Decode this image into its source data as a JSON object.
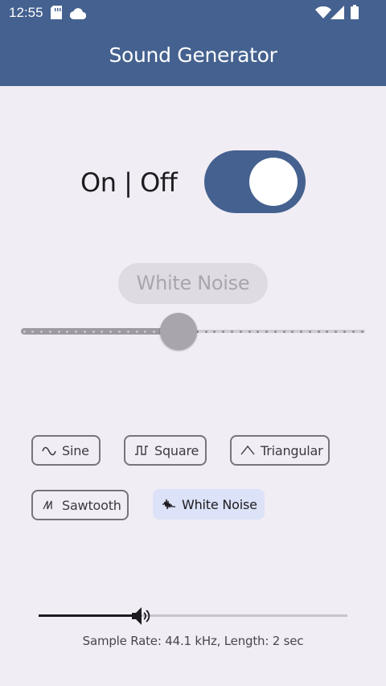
{
  "status_bar": {
    "time": "12:55",
    "icons": [
      "sd-card-icon",
      "cloud-icon",
      "wifi-icon",
      "signal-icon",
      "battery-icon"
    ]
  },
  "app_bar": {
    "title": "Sound Generator",
    "color": "#44618f"
  },
  "power": {
    "label": "On | Off",
    "state": "on"
  },
  "selected_wave_label": "White Noise",
  "frequency_slider": {
    "value_fraction": 0.46,
    "steps": 39,
    "enabled": false
  },
  "wave_types": [
    {
      "label": "Sine",
      "icon": "sine-wave-icon",
      "selected": false
    },
    {
      "label": "Square",
      "icon": "square-wave-icon",
      "selected": false
    },
    {
      "label": "Triangular",
      "icon": "triangle-wave-icon",
      "selected": false
    },
    {
      "label": "Sawtooth",
      "icon": "sawtooth-wave-icon",
      "selected": false
    },
    {
      "label": "White Noise",
      "icon": "noise-wave-icon",
      "selected": true
    }
  ],
  "rate_slider": {
    "value_fraction": 0.32,
    "thumb_icon": "speaker-icon"
  },
  "sample_info": "Sample Rate: 44.1 kHz, Length: 2 sec",
  "colors": {
    "accent": "#44618f",
    "background": "#f1edf5",
    "chip_selected": "#dce2f7"
  }
}
